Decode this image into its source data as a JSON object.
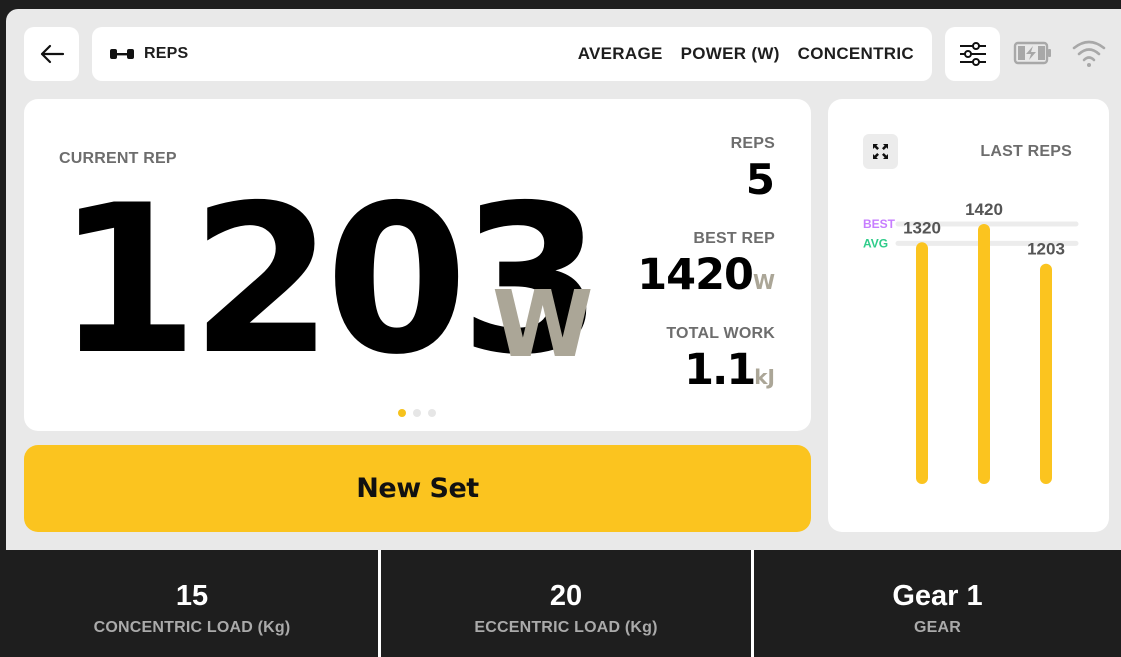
{
  "topbar": {
    "reps_label": "REPS",
    "options": [
      "AVERAGE",
      "POWER (W)",
      "CONCENTRIC"
    ]
  },
  "main": {
    "current_label": "CURRENT REP",
    "current_value": "1203",
    "current_unit": "W",
    "reps_label": "REPS",
    "reps_value": "5",
    "best_label": "BEST REP",
    "best_value": "1420",
    "best_unit": "W",
    "work_label": "TOTAL WORK",
    "work_value": "1.1",
    "work_unit": "kJ",
    "page_dots": 3,
    "active_dot": 0
  },
  "new_set_label": "New Set",
  "last_reps": {
    "title": "LAST REPS",
    "best_label": "BEST",
    "avg_label": "AVG"
  },
  "chart_data": {
    "type": "bar",
    "categories": [
      "",
      "",
      ""
    ],
    "values": [
      1320,
      1420,
      1203
    ],
    "title": "LAST REPS",
    "xlabel": "",
    "ylabel": "",
    "reference_lines": [
      {
        "name": "BEST",
        "value": 1420,
        "color": "#c77dff"
      },
      {
        "name": "AVG",
        "value": 1314,
        "color": "#2ecc8a"
      }
    ],
    "bar_color": "#fbc41f",
    "grid": false
  },
  "bottom": [
    {
      "value": "15",
      "label": "CONCENTRIC LOAD (Kg)"
    },
    {
      "value": "20",
      "label": "ECCENTRIC LOAD (Kg)"
    },
    {
      "value": "Gear 1",
      "label": "GEAR"
    }
  ],
  "colors": {
    "accent": "#fbc41f",
    "unit_gray": "#aba697",
    "background": "#e9e9e9",
    "panel_dark": "#1e1e1e"
  },
  "icons": {
    "back": "arrow-left-icon",
    "reps": "dumbbell-icon",
    "filter": "sliders-icon",
    "battery": "battery-charging-icon",
    "wifi": "wifi-icon",
    "expand": "expand-icon"
  }
}
